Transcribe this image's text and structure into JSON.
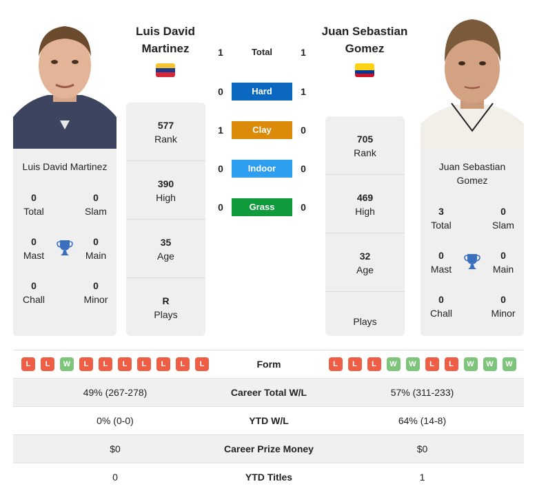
{
  "players": [
    {
      "name_line1": "Luis David",
      "name_line2": "Martinez",
      "card_name": "Luis David Martinez",
      "flag": "venezuela-flag",
      "flag_colors": [
        "#f4c430",
        "#1e3a8a",
        "#d62839"
      ],
      "stats": [
        {
          "value": "577",
          "label": "Rank"
        },
        {
          "value": "390",
          "label": "High"
        },
        {
          "value": "35",
          "label": "Age"
        },
        {
          "value": "R",
          "label": "Plays"
        }
      ],
      "titles": {
        "total": {
          "value": "0",
          "label": "Total"
        },
        "slam": {
          "value": "0",
          "label": "Slam"
        },
        "mast": {
          "value": "0",
          "label": "Mast"
        },
        "main": {
          "value": "0",
          "label": "Main"
        },
        "chall": {
          "value": "0",
          "label": "Chall"
        },
        "minor": {
          "value": "0",
          "label": "Minor"
        }
      }
    },
    {
      "name_line1": "Juan Sebastian",
      "name_line2": "Gomez",
      "card_name_line1": "Juan Sebastian",
      "card_name_line2": "Gomez",
      "flag": "colombia-flag",
      "flag_colors": [
        "#fcd116",
        "#003893",
        "#ce1126"
      ],
      "stats": [
        {
          "value": "705",
          "label": "Rank"
        },
        {
          "value": "469",
          "label": "High"
        },
        {
          "value": "32",
          "label": "Age"
        },
        {
          "value": "",
          "label": "Plays"
        }
      ],
      "titles": {
        "total": {
          "value": "3",
          "label": "Total"
        },
        "slam": {
          "value": "0",
          "label": "Slam"
        },
        "mast": {
          "value": "0",
          "label": "Mast"
        },
        "main": {
          "value": "0",
          "label": "Main"
        },
        "chall": {
          "value": "0",
          "label": "Chall"
        },
        "minor": {
          "value": "0",
          "label": "Minor"
        }
      }
    }
  ],
  "h2h": [
    {
      "label": "Total",
      "left": "1",
      "right": "1",
      "color": ""
    },
    {
      "label": "Hard",
      "left": "0",
      "right": "1",
      "color": "#0a68c0"
    },
    {
      "label": "Clay",
      "left": "1",
      "right": "0",
      "color": "#dc8a0a"
    },
    {
      "label": "Indoor",
      "left": "0",
      "right": "0",
      "color": "#2e9ef0"
    },
    {
      "label": "Grass",
      "left": "0",
      "right": "0",
      "color": "#0f9a3c"
    }
  ],
  "table": {
    "form_label": "Form",
    "form_left": [
      "L",
      "L",
      "W",
      "L",
      "L",
      "L",
      "L",
      "L",
      "L",
      "L"
    ],
    "form_right": [
      "L",
      "L",
      "L",
      "W",
      "W",
      "L",
      "L",
      "W",
      "W",
      "W"
    ],
    "rows": [
      {
        "label": "Career Total W/L",
        "left": "49% (267-278)",
        "right": "57% (311-233)"
      },
      {
        "label": "YTD W/L",
        "left": "0% (0-0)",
        "right": "64% (14-8)"
      },
      {
        "label": "Career Prize Money",
        "left": "$0",
        "right": "$0"
      },
      {
        "label": "YTD Titles",
        "left": "0",
        "right": "1"
      }
    ]
  },
  "colors": {
    "trophy": "#3a6fc0",
    "loss": "#ee5e45",
    "win": "#7cc57a"
  }
}
